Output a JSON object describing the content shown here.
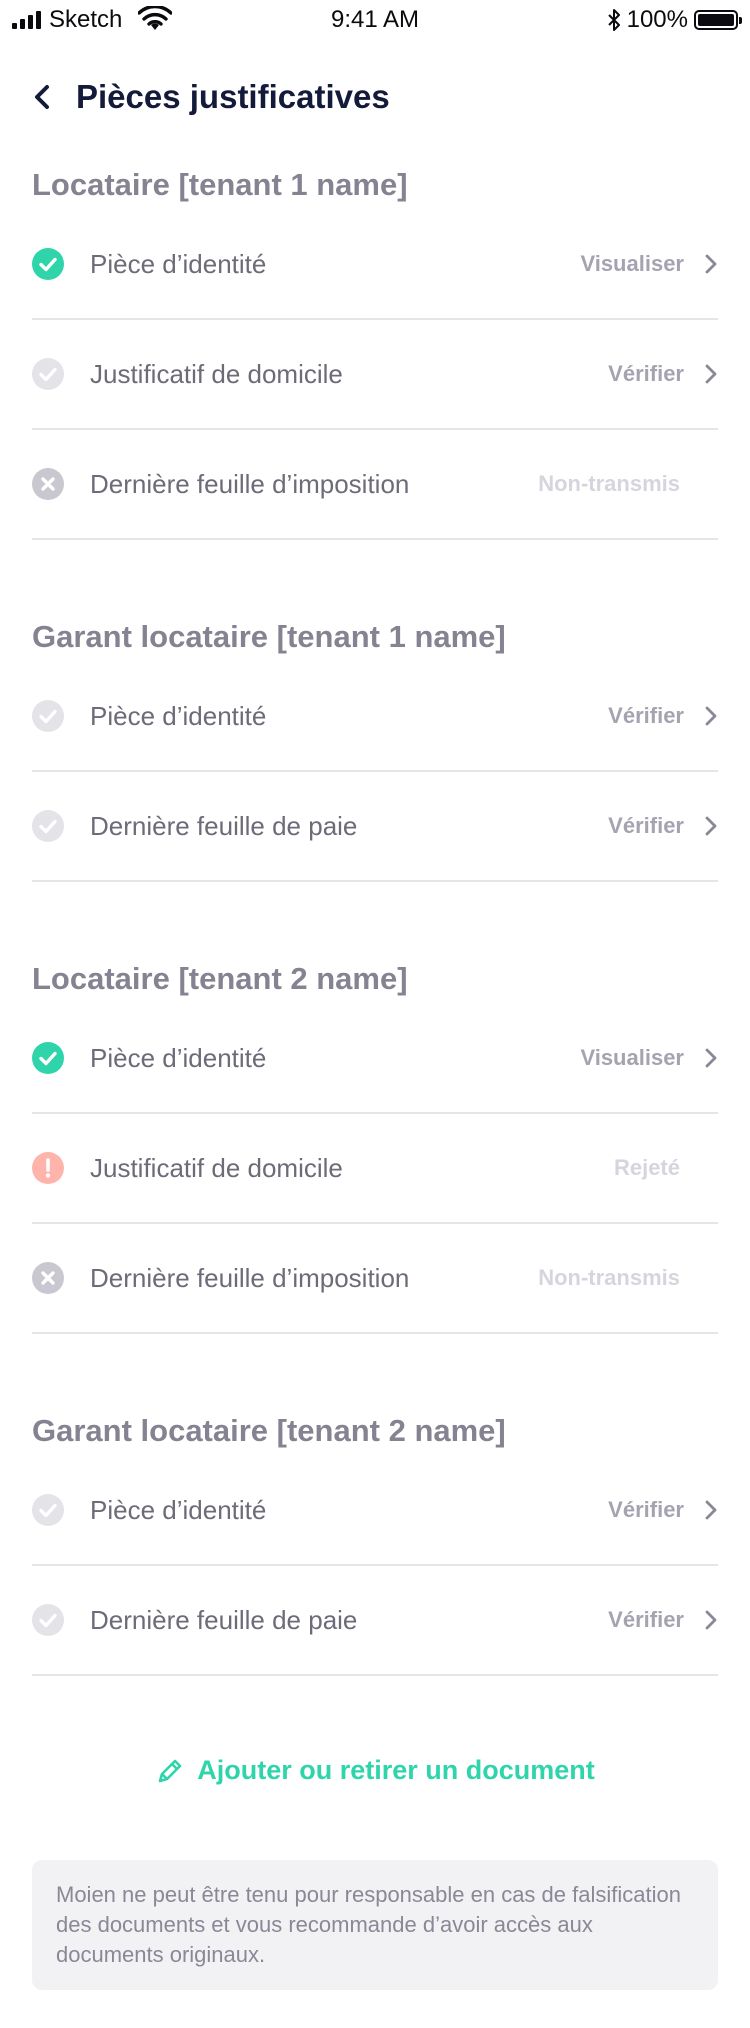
{
  "status_bar": {
    "carrier": "Sketch",
    "time": "9:41 AM",
    "battery": "100%"
  },
  "nav": {
    "title": "Pièces justificatives"
  },
  "sections": [
    {
      "title": "Locataire [tenant 1 name]",
      "rows": [
        {
          "label": "Pièce d’identité",
          "status": "check",
          "action": "Visualiser",
          "chevron": true
        },
        {
          "label": "Justificatif de domicile",
          "status": "pending",
          "action": "Vérifier",
          "chevron": true
        },
        {
          "label": "Dernière feuille d’imposition",
          "status": "missing",
          "action": "Non-transmis",
          "chevron": false
        }
      ]
    },
    {
      "title": "Garant locataire [tenant 1 name]",
      "rows": [
        {
          "label": "Pièce d’identité",
          "status": "pending",
          "action": "Vérifier",
          "chevron": true
        },
        {
          "label": "Dernière feuille de paie",
          "status": "pending",
          "action": "Vérifier",
          "chevron": true
        }
      ]
    },
    {
      "title": "Locataire [tenant 2 name]",
      "rows": [
        {
          "label": "Pièce d’identité",
          "status": "check",
          "action": "Visualiser",
          "chevron": true
        },
        {
          "label": "Justificatif de domicile",
          "status": "rejected",
          "action": "Rejeté",
          "chevron": false
        },
        {
          "label": "Dernière feuille d’imposition",
          "status": "missing",
          "action": "Non-transmis",
          "chevron": false
        }
      ]
    },
    {
      "title": "Garant locataire [tenant 2 name]",
      "rows": [
        {
          "label": "Pièce d’identité",
          "status": "pending",
          "action": "Vérifier",
          "chevron": true
        },
        {
          "label": "Dernière feuille de paie",
          "status": "pending",
          "action": "Vérifier",
          "chevron": true
        }
      ]
    }
  ],
  "add_link": {
    "label": "Ajouter ou retirer un document"
  },
  "disclaimer": {
    "text": "Moien ne peut être tenu pour responsable en cas de falsification des documents et vous recommande d’avoir accès aux documents originaux."
  },
  "colors": {
    "accent": "#2fd4ab",
    "check": "#2fd4ab",
    "pending": "#e3e3e8",
    "missing": "#c9c8d1",
    "rejected": "#ffb4ab"
  }
}
